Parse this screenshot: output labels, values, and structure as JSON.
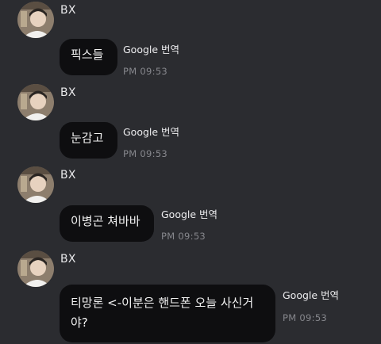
{
  "messages": [
    {
      "sender": "BX",
      "text": "픽스들",
      "translate_label": "Google 번역",
      "time": "PM 09:53"
    },
    {
      "sender": "BX",
      "text": "눈감고",
      "translate_label": "Google 번역",
      "time": "PM 09:53"
    },
    {
      "sender": "BX",
      "text": "이병곤 쳐바바",
      "translate_label": "Google 번역",
      "time": "PM 09:53"
    },
    {
      "sender": "BX",
      "text": "티망론 <-이분은 핸드폰 오늘 사신거야?",
      "translate_label": "Google 번역",
      "time": "PM 09:53"
    }
  ]
}
